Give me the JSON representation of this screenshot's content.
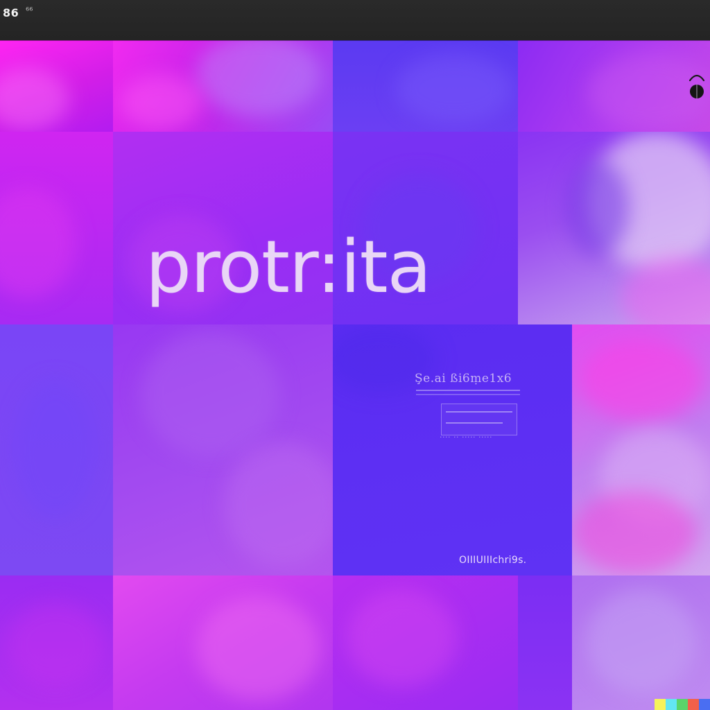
{
  "window": {
    "title": "86",
    "tab_glyph": "⁶⁶"
  },
  "hero": {
    "wordmark": "protr:ita"
  },
  "caption": {
    "title": "Şe.ai ßi6ṃe1x6",
    "foot": "···· ·· ····· ·····"
  },
  "tile_credit": "OIIIUIIIchri9s.",
  "icons": {
    "status": "microphone-icon"
  },
  "colors": {
    "topbar": "#242424",
    "wordmark": "#e9d6f6",
    "accent_magenta": "#ff25f2",
    "accent_violet": "#5b2cf2",
    "accent_lavender": "#c9a6ef"
  },
  "color_strip": [
    "#f6f25a",
    "#62e6f2",
    "#5ad46a",
    "#f2604a",
    "#4a6ef2"
  ]
}
